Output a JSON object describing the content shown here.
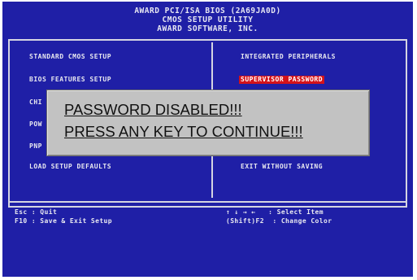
{
  "header": {
    "line1": "AWARD PCI/ISA BIOS (2A69JA0D)",
    "line2": "CMOS SETUP UTILITY",
    "line3": "AWARD SOFTWARE, INC."
  },
  "menu": {
    "left": [
      {
        "label": "STANDARD CMOS SETUP"
      },
      {
        "label": "BIOS FEATURES SETUP"
      },
      {
        "label": "CHI"
      },
      {
        "label": "POW"
      },
      {
        "label": "PNP"
      },
      {
        "label": "LOAD SETUP DEFAULTS"
      }
    ],
    "right": [
      {
        "label": "INTEGRATED PERIPHERALS"
      },
      {
        "label": "SUPERVISOR PASSWORD",
        "selected": true
      },
      {
        "label": "EXIT WITHOUT SAVING"
      }
    ]
  },
  "footer": {
    "left_line1": "Esc : Quit",
    "left_line2": "F10 : Save & Exit Setup",
    "right_line1": "↑ ↓ → ←   : Select Item",
    "right_line2": "(Shift)F2  : Change Color"
  },
  "dialog": {
    "line1": "PASSWORD DISABLED!!!",
    "line2": "PRESS ANY KEY TO CONTINUE!!!"
  },
  "colors": {
    "background": "#1f1fa6",
    "selected": "#d4121a",
    "dialog": "#c2c2c2"
  }
}
